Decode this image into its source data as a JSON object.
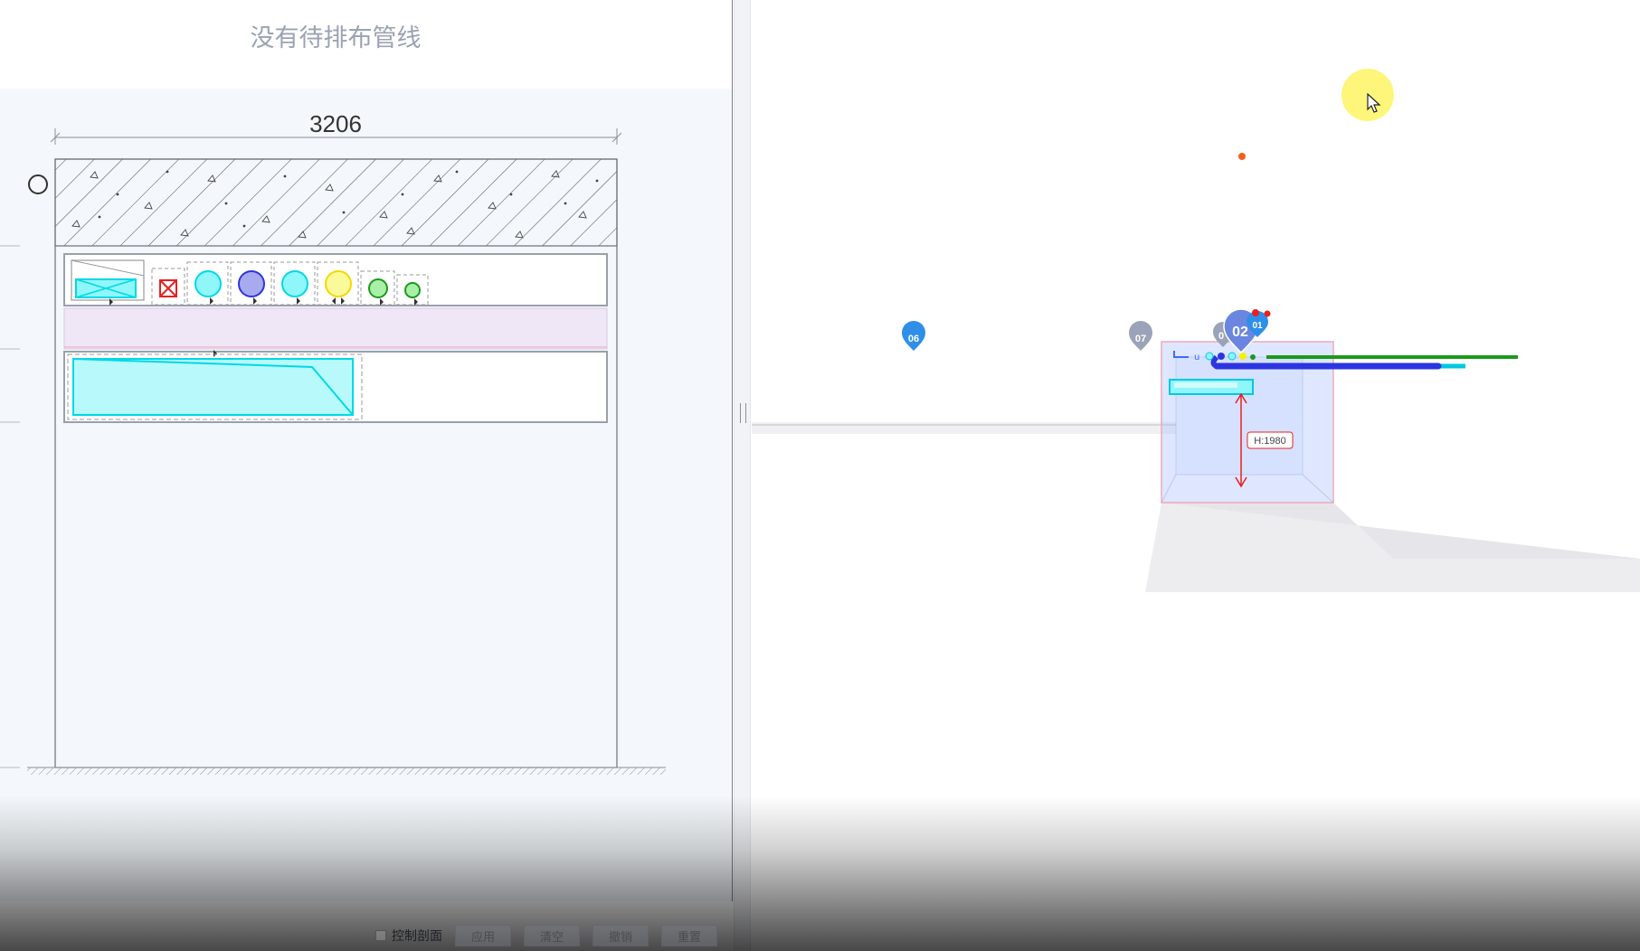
{
  "left_panel": {
    "empty_message": "没有待排布管线",
    "section": {
      "width_dimension": "3206"
    }
  },
  "viewport": {
    "markers": [
      {
        "label": "06",
        "color": "#2f8fe8"
      },
      {
        "label": "07",
        "color": "#9aa3b8"
      },
      {
        "label": "0",
        "color": "#9aa3b8"
      },
      {
        "label": "02",
        "color": "#6a86e0"
      },
      {
        "label": "01",
        "color": "#2f8fe8"
      }
    ],
    "height_label": "H:1980"
  },
  "toolbar": {
    "control_section_label": "控制剖面",
    "buttons": [
      "应用",
      "清空",
      "撤销",
      "重置"
    ]
  },
  "colors": {
    "cyan_pipe": "#00e5f0",
    "blue_pipe": "#2c35e0",
    "green_pipe": "#1a9a1a",
    "yellow_pipe": "#f5f200",
    "red_valve": "#e82020",
    "pink_band": "#efe6f6"
  }
}
